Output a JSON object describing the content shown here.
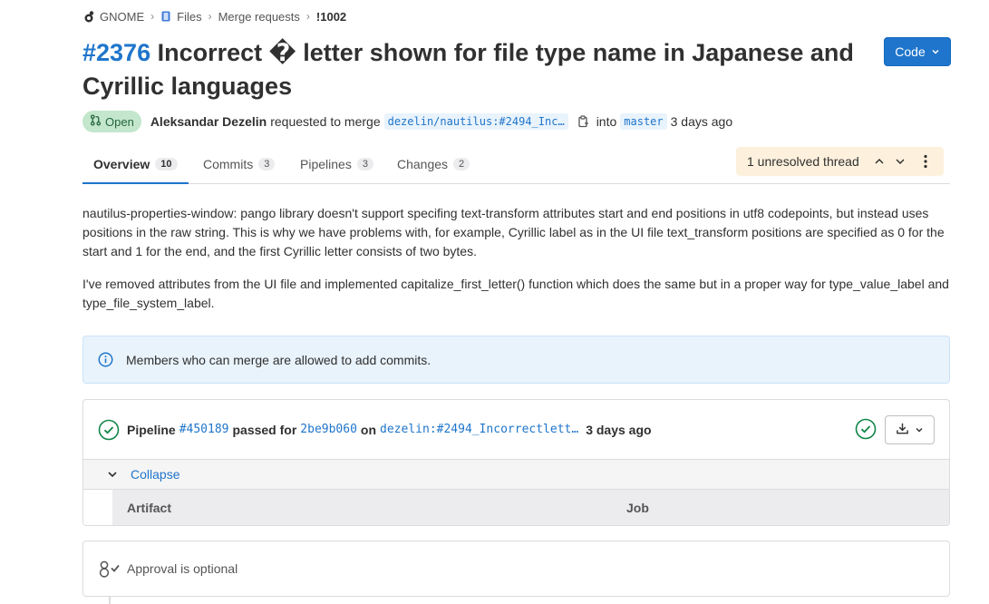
{
  "breadcrumb": {
    "group": "GNOME",
    "project": "Files",
    "section": "Merge requests",
    "current": "!1002"
  },
  "header": {
    "mr_ref": "#2376",
    "title": " Incorrect � letter shown for file type name in Japanese and Cyrillic languages",
    "code_button": "Code"
  },
  "meta": {
    "status": "Open",
    "author": "Aleksandar Dezelin",
    "requested_text": "requested to merge",
    "source_branch": "dezelin/nautilus:#2494_Inc…",
    "into_text": "into",
    "target_branch": "master",
    "time": "3 days ago"
  },
  "tabs": [
    {
      "label": "Overview",
      "count": "10"
    },
    {
      "label": "Commits",
      "count": "3"
    },
    {
      "label": "Pipelines",
      "count": "3"
    },
    {
      "label": "Changes",
      "count": "2"
    }
  ],
  "threads": {
    "label": "1 unresolved thread"
  },
  "description": {
    "p1": "nautilus-properties-window: pango library doesn't support specifing text-transform attributes start and end positions in utf8 codepoints, but instead uses positions in the raw string. This is why we have problems with, for example, Cyrillic label as in the UI file text_transform positions are specified as 0 for the start and 1 for the end, and the first Cyrillic letter consists of two bytes.",
    "p2": "I've removed attributes from the UI file and implemented capitalize_first_letter() function which does the same but in a proper way for type_value_label and type_file_system_label."
  },
  "info": {
    "text": "Members who can merge are allowed to add commits."
  },
  "pipeline": {
    "label": "Pipeline",
    "id": "#450189",
    "passed_for": "passed for",
    "commit": "2be9b060",
    "on": "on",
    "branch": "dezelin:#2494_Incorrectlett…",
    "time": "3 days ago",
    "collapse": "Collapse",
    "col_artifact": "Artifact",
    "col_job": "Job"
  },
  "approval": {
    "text": "Approval is optional"
  },
  "colors": {
    "accent": "#1f75cb",
    "success": "#108548",
    "open_badge_bg": "#c3e6cd",
    "warning_bg": "#fdf1dd"
  }
}
